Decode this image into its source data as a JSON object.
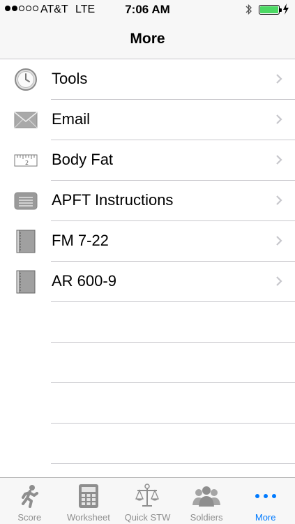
{
  "status_bar": {
    "carrier": "AT&T",
    "network": "LTE",
    "time": "7:06 AM",
    "signal_bars": 2,
    "signal_total": 5,
    "battery_level": 1.0
  },
  "nav": {
    "title": "More"
  },
  "list": {
    "items": [
      {
        "label": "Tools",
        "icon": "clock-icon"
      },
      {
        "label": "Email",
        "icon": "envelope-icon"
      },
      {
        "label": "Body Fat",
        "icon": "ruler-icon"
      },
      {
        "label": "APFT Instructions",
        "icon": "list-document-icon"
      },
      {
        "label": "FM 7-22",
        "icon": "book-icon"
      },
      {
        "label": "AR 600-9",
        "icon": "book-icon"
      }
    ]
  },
  "tabbar": {
    "tabs": [
      {
        "label": "Score",
        "icon": "runner-icon"
      },
      {
        "label": "Worksheet",
        "icon": "calculator-icon"
      },
      {
        "label": "Quick STW",
        "icon": "scale-icon"
      },
      {
        "label": "Soldiers",
        "icon": "people-icon"
      },
      {
        "label": "More",
        "icon": "more-dots-icon"
      }
    ],
    "active": "More",
    "active_color": "#007aff",
    "inactive_color": "#8e8e8e"
  }
}
